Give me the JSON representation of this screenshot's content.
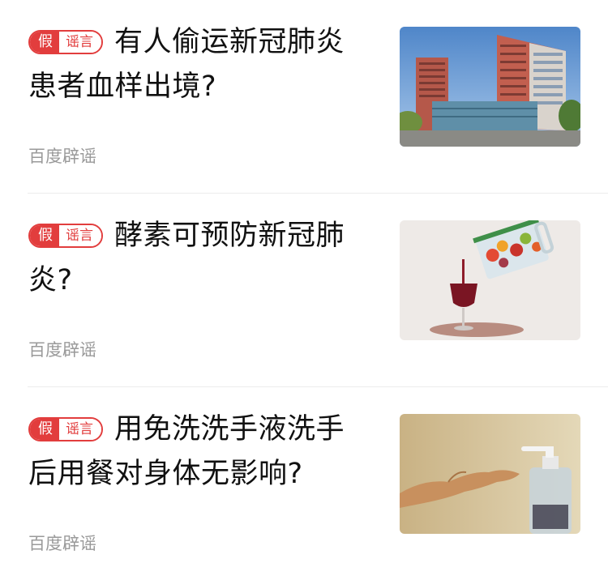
{
  "items": [
    {
      "verdict": "假",
      "category": "谣言",
      "title": "有人偷运新冠肺炎患者血样出境?",
      "source": "百度辟谣",
      "image": "hospital-building-photo"
    },
    {
      "verdict": "假",
      "category": "谣言",
      "title": "酵素可预防新冠肺炎?",
      "source": "百度辟谣",
      "image": "fruit-enzyme-jug-photo"
    },
    {
      "verdict": "假",
      "category": "谣言",
      "title": "用免洗洗手液洗手后用餐对身体无影响?",
      "source": "百度辟谣",
      "image": "hand-sanitizer-photo"
    }
  ],
  "colors": {
    "badge_red": "#e23d3d",
    "title_text": "#111111",
    "source_text": "#9a9a9a",
    "divider": "#ececec"
  }
}
